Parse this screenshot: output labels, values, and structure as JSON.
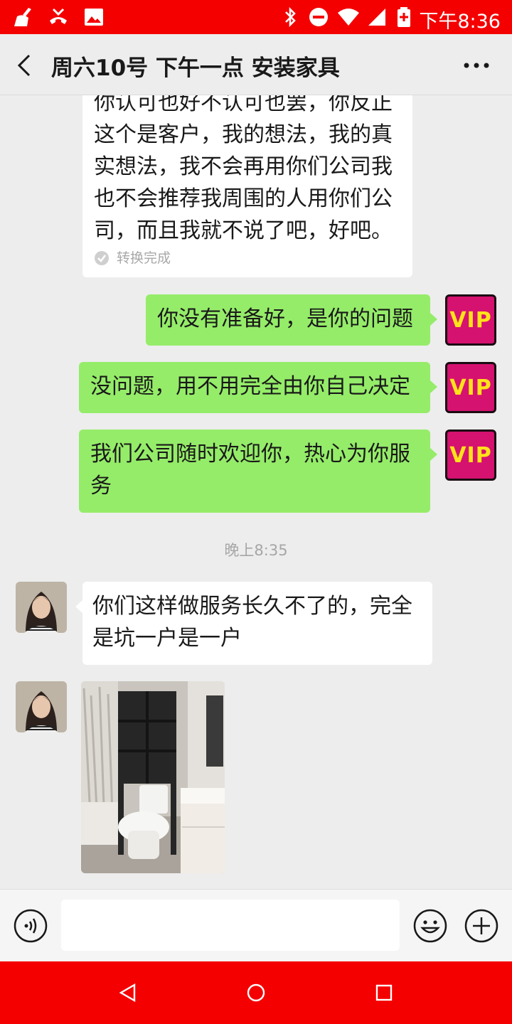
{
  "status_bar": {
    "time": "下午8:36",
    "icons": [
      "broom-icon",
      "missed-call-icon",
      "image-icon",
      "bluetooth-icon",
      "dnd-icon",
      "wifi-icon",
      "signal-icon",
      "battery-charging-icon"
    ]
  },
  "header": {
    "title": "周六10号 下午一点 安装家具",
    "back_icon": "back-chevron-icon",
    "more_icon": "more-dots-icon"
  },
  "messages": {
    "m1": {
      "direction": "incoming",
      "lines": [
        "你认可也好不认可也罢，你反正",
        "这个是客户，我的想法，我的真",
        "实想法，我不会再用你们公司我",
        "也不会推荐我周围的人用你们公",
        "司，而且我就不说了吧，好吧。"
      ],
      "status": "转换完成"
    },
    "m2": {
      "direction": "outgoing",
      "text": "你没有准备好，是你的问题",
      "badge": "VIP"
    },
    "m3": {
      "direction": "outgoing",
      "text": "没问题，用不用完全由你自己决定",
      "badge": "VIP"
    },
    "m4": {
      "direction": "outgoing",
      "lines": [
        "我们公司随时欢迎你，热心为你服",
        "务"
      ],
      "badge": "VIP"
    },
    "timestamp": "晚上8:35",
    "m5": {
      "direction": "incoming",
      "lines": [
        "你们这样做服务长久不了的，完全",
        "是坑一户是一户"
      ]
    },
    "m6": {
      "direction": "incoming",
      "type": "image"
    }
  },
  "input_bar": {
    "voice_icon": "voice-icon",
    "emoji_icon": "emoji-icon",
    "add_icon": "plus-circle-icon"
  },
  "nav_bar": {
    "icons": [
      "back-triangle-icon",
      "home-circle-icon",
      "recents-square-icon"
    ]
  },
  "colors": {
    "status_bar": "#f40000",
    "outgoing_bubble": "#95ec69",
    "incoming_bubble": "#ffffff",
    "vip_badge": "#d5126f",
    "vip_text": "#ffe21a"
  }
}
